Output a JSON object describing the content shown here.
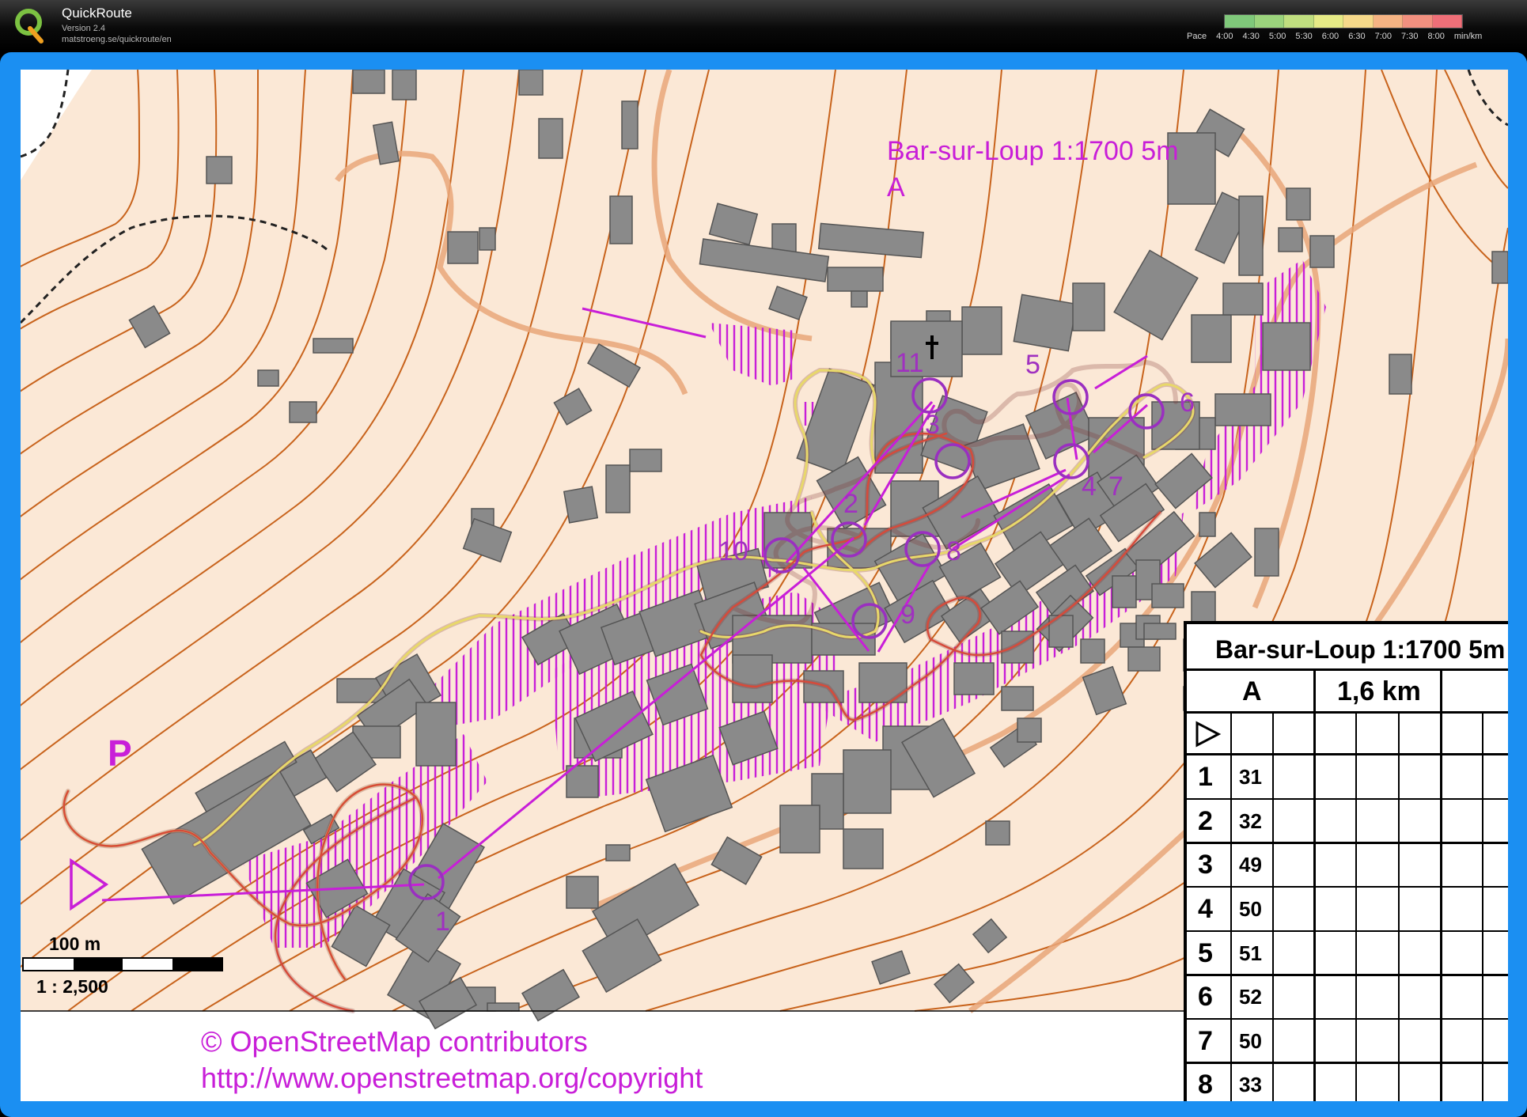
{
  "app": {
    "name": "QuickRoute",
    "version": "Version 2.4",
    "url": "matstroeng.se/quickroute/en"
  },
  "pace_scale": {
    "label": "Pace",
    "unit": "min/km",
    "ticks": [
      "4:00",
      "4:30",
      "5:00",
      "5:30",
      "6:00",
      "6:30",
      "7:00",
      "7:30",
      "8:00"
    ],
    "colors": [
      "#7fc87a",
      "#9bd37c",
      "#c0de7f",
      "#e6ea86",
      "#f6d98a",
      "#f5b383",
      "#f2907f",
      "#ef6f78"
    ]
  },
  "map": {
    "title": "Bar-sur-Loup 1:1700 5m",
    "course": "A",
    "parking_symbol": "P",
    "colors": {
      "background": "#fbe8d6",
      "contour": "#c8631c",
      "building": "#8a8a8a",
      "course": "#c81ed8",
      "route": "#d64a3a",
      "control_circle": "#9a2fc0"
    },
    "controls": [
      {
        "label": "1"
      },
      {
        "label": "2"
      },
      {
        "label": "3"
      },
      {
        "label": "4"
      },
      {
        "label": "5"
      },
      {
        "label": "6"
      },
      {
        "label": "7"
      },
      {
        "label": "8"
      },
      {
        "label": "9"
      },
      {
        "label": "10"
      },
      {
        "label": "11"
      }
    ],
    "scale": {
      "distance": "100 m",
      "ratio": "1 : 2,500"
    },
    "copyright": {
      "line1": "© OpenStreetMap contributors",
      "line2": "http://www.openstreetmap.org/copyright"
    }
  },
  "control_card": {
    "title": "Bar-sur-Loup 1:1700 5m",
    "course": "A",
    "length": "1,6 km",
    "rows": [
      {
        "number": "1",
        "code": "31"
      },
      {
        "number": "2",
        "code": "32"
      },
      {
        "number": "3",
        "code": "49"
      },
      {
        "number": "4",
        "code": "50"
      },
      {
        "number": "5",
        "code": "51"
      },
      {
        "number": "6",
        "code": "52"
      },
      {
        "number": "7",
        "code": "50"
      },
      {
        "number": "8",
        "code": "33"
      }
    ]
  }
}
